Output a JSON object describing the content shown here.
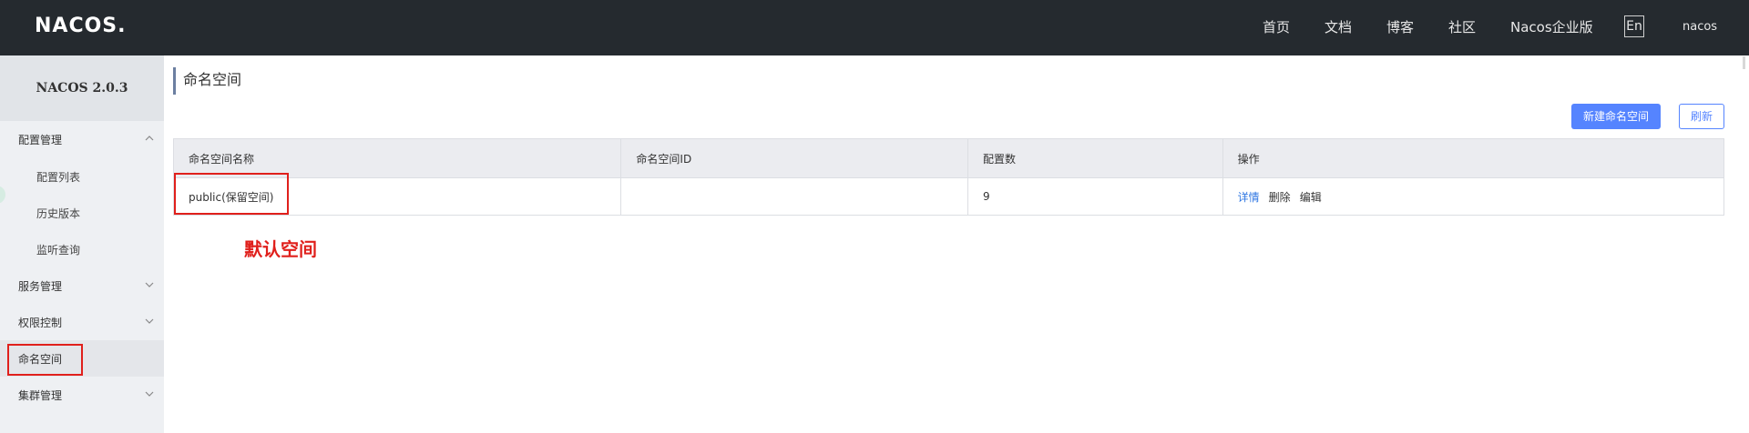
{
  "header": {
    "logo_text": "NACOS",
    "logo_dot": ".",
    "nav": [
      "首页",
      "文档",
      "博客",
      "社区",
      "Nacos企业版"
    ],
    "lang": "En",
    "user": "nacos"
  },
  "sidebar": {
    "title": "NACOS 2.0.3",
    "items": [
      {
        "label": "配置管理",
        "type": "group",
        "icon": "chevron-up-icon"
      },
      {
        "label": "配置列表",
        "type": "sub"
      },
      {
        "label": "历史版本",
        "type": "sub"
      },
      {
        "label": "监听查询",
        "type": "sub"
      },
      {
        "label": "服务管理",
        "type": "group",
        "icon": "chevron-down-icon"
      },
      {
        "label": "权限控制",
        "type": "group",
        "icon": "chevron-down-icon"
      },
      {
        "label": "命名空间",
        "type": "group",
        "active": true
      },
      {
        "label": "集群管理",
        "type": "group",
        "icon": "chevron-down-icon"
      }
    ]
  },
  "main": {
    "title": "命名空间",
    "buttons": {
      "create": "新建命名空间",
      "refresh": "刷新"
    },
    "table": {
      "headers": [
        "命名空间名称",
        "命名空间ID",
        "配置数",
        "操作"
      ],
      "rows": [
        {
          "name": "public(保留空间)",
          "id": "",
          "count": "9",
          "actions": [
            "详情",
            "删除",
            "编辑"
          ]
        }
      ]
    },
    "annotation": "默认空间"
  },
  "colors": {
    "accent": "#5584ff",
    "link": "#2e76e2",
    "highlight": "#e0201c",
    "header_bg": "#252a2f",
    "sidebar_bg": "#eef0f3"
  }
}
